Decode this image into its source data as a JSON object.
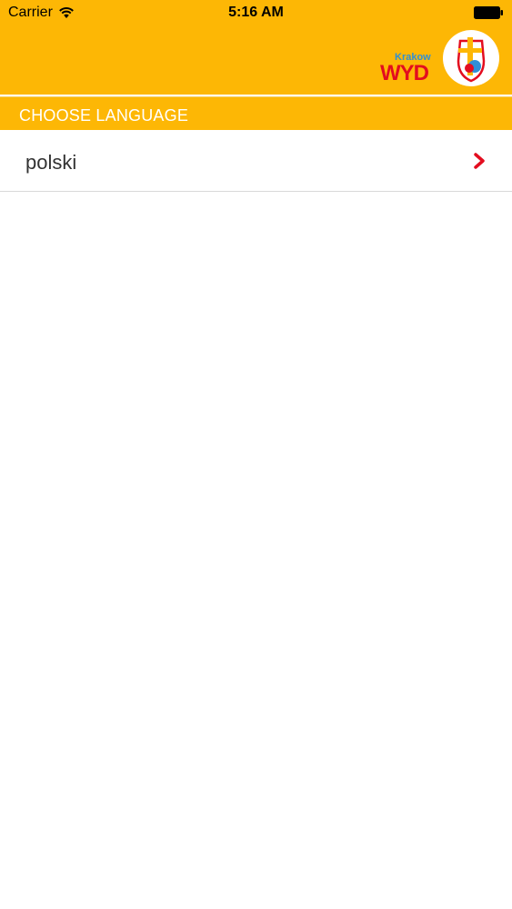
{
  "status_bar": {
    "carrier": "Carrier",
    "time": "5:16 AM",
    "wifi_icon": "wifi-icon",
    "battery_icon": "battery-full-icon"
  },
  "header": {
    "background_color": "#fdb705",
    "logo": {
      "city": "Krakow",
      "wordmark": "WYD",
      "emblem_icon": "wyd-emblem-icon"
    }
  },
  "section": {
    "title": "CHOOSE LANGUAGE"
  },
  "languages": [
    {
      "label": "polski",
      "icon": "chevron-right-icon",
      "icon_color": "#e30d1f"
    }
  ]
}
